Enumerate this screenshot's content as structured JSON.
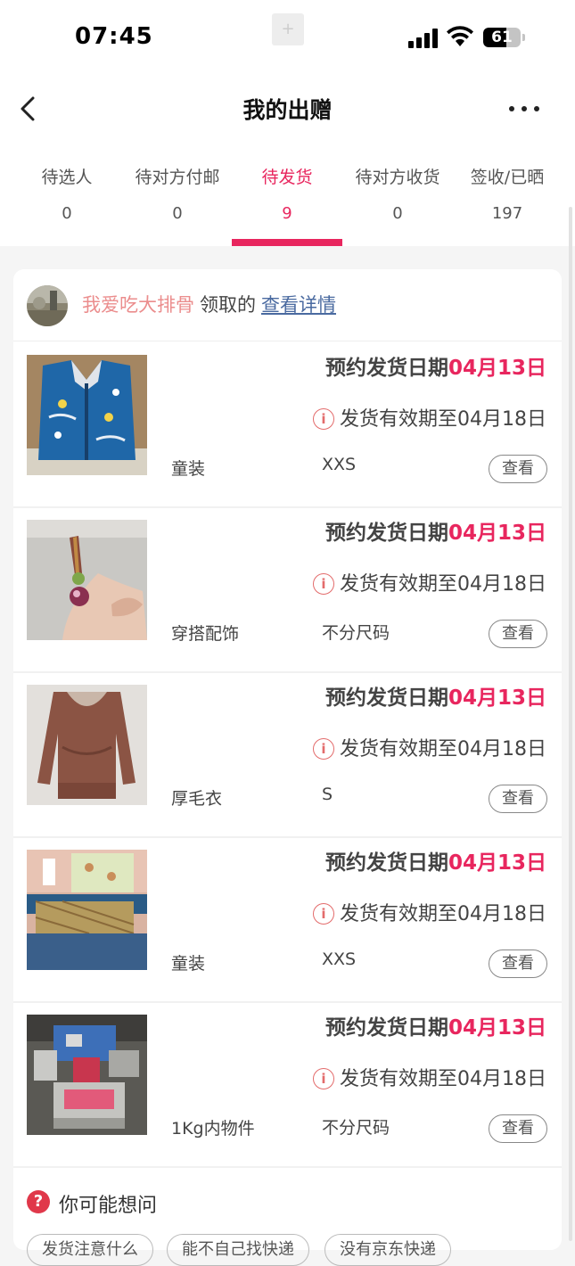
{
  "status_bar": {
    "time": "07:45",
    "battery": "61"
  },
  "nav": {
    "title": "我的出赠"
  },
  "tabs": [
    {
      "label": "待选人",
      "count": "0"
    },
    {
      "label": "待对方付邮",
      "count": "0"
    },
    {
      "label": "待发货",
      "count": "9",
      "active": true
    },
    {
      "label": "待对方收货",
      "count": "0"
    },
    {
      "label": "签收/已晒",
      "count": "197"
    }
  ],
  "claim": {
    "user": "我爱吃大排骨",
    "text": "领取的",
    "link": "查看详情"
  },
  "schedule_label": "预约发货日期",
  "validity_icon_text": "i",
  "view_label": "查看",
  "items": [
    {
      "image": "blue-kids-vest-photo",
      "schedule_date": "04月13日",
      "valid_until": "发货有效期至04月18日",
      "category": "童装",
      "size": "XXS"
    },
    {
      "image": "beaded-keychain-photo",
      "schedule_date": "04月13日",
      "valid_until": "发货有效期至04月18日",
      "category": "穿搭配饰",
      "size": "不分尺码"
    },
    {
      "image": "brown-sweater-photo",
      "schedule_date": "04月13日",
      "valid_until": "发货有效期至04月18日",
      "category": "厚毛衣",
      "size": "S"
    },
    {
      "image": "kids-clothes-photo",
      "schedule_date": "04月13日",
      "valid_until": "发货有效期至04月18日",
      "category": "童装",
      "size": "XXS"
    },
    {
      "image": "robot-toy-photo",
      "schedule_date": "04月13日",
      "valid_until": "发货有效期至04月18日",
      "category": "1Kg内物件",
      "size": "不分尺码"
    }
  ],
  "faq": {
    "icon_text": "?",
    "title": "你可能想问",
    "chips": [
      "发货注意什么",
      "能不自己找快递",
      "没有京东快递"
    ]
  },
  "colors": {
    "accent": "#e8265e",
    "link": "#4a6aa0",
    "username": "#eb8d8d"
  }
}
